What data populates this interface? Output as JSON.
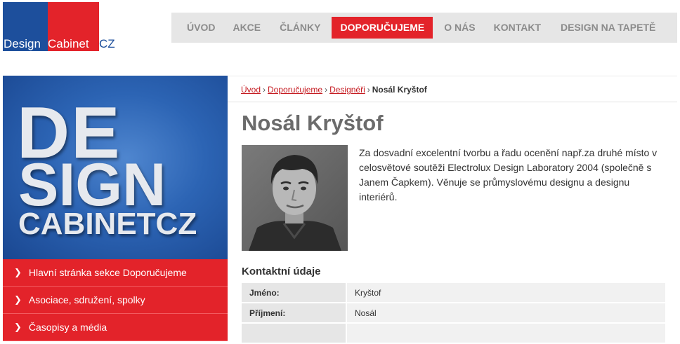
{
  "logo": {
    "part1": "Design",
    "part2": "Cabinet",
    "part3": "CZ"
  },
  "nav": {
    "items": [
      {
        "label": "ÚVOD",
        "active": false
      },
      {
        "label": "AKCE",
        "active": false
      },
      {
        "label": "ČLÁNKY",
        "active": false
      },
      {
        "label": "DOPORUČUJEME",
        "active": true
      },
      {
        "label": "O NÁS",
        "active": false
      },
      {
        "label": "KONTAKT",
        "active": false
      },
      {
        "label": "DESIGN NA TAPETĚ",
        "active": false
      }
    ]
  },
  "hero": {
    "line1": "DE",
    "line2": "SIGN",
    "line3": "CABINETCZ"
  },
  "sidebar": {
    "items": [
      {
        "label": "Hlavní stránka sekce Doporučujeme"
      },
      {
        "label": "Asociace, sdružení, spolky"
      },
      {
        "label": "Časopisy a média"
      }
    ]
  },
  "breadcrumb": {
    "links": [
      "Úvod",
      "Doporučujeme",
      "Designéři"
    ],
    "separator": "›",
    "current": "Nosál Kryštof"
  },
  "page": {
    "title": "Nosál Kryštof",
    "bio": "Za dosvadní excelentní tvorbu a řadu ocenění např.za druhé místo v celosvětové soutěži Electrolux Design Laboratory 2004 (společně s Janem Čapkem). Věnuje se průmyslovému designu a designu interiérů."
  },
  "contact": {
    "title": "Kontaktní údaje",
    "rows": [
      {
        "key": "Jméno:",
        "value": "Kryštof"
      },
      {
        "key": "Příjmení:",
        "value": "Nosál"
      },
      {
        "key": "",
        "value": ""
      }
    ]
  },
  "colors": {
    "brand_red": "#e3232a",
    "brand_blue": "#1d4f9c"
  }
}
